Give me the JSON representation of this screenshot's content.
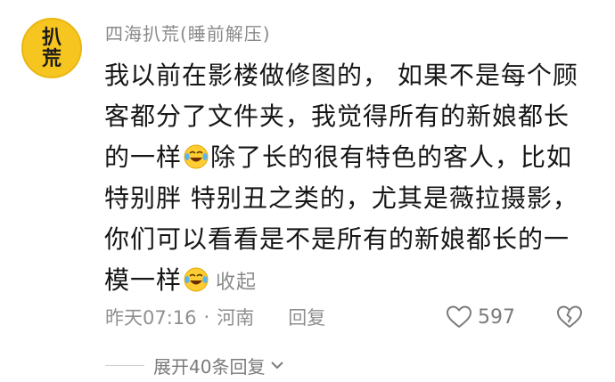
{
  "comment": {
    "avatar": {
      "line1": "扒",
      "line2": "荒",
      "color": "#f7c51f"
    },
    "username": "四海扒荒(睡前解压)",
    "body": {
      "line1": "我以前在影楼做修图的， 如果不是每个顾",
      "line2": "客都分了文件夹，我觉得所有的新娘都长",
      "line3a": "的一样",
      "line3b": "除了长的很有特色的客人，比如",
      "line4": "特别胖 特别丑之类的，尤其是薇拉摄影，",
      "line5": "你们可以看看是不是所有的新娘都长的一",
      "line6": "模一样",
      "collapse_label": "收起",
      "emoji_icon": "laughing-tears-emoji"
    },
    "meta": {
      "time": "昨天07:16",
      "separator": "·",
      "location": "河南",
      "reply_label": "回复"
    },
    "likes": {
      "count": "597",
      "icon": "heart-outline-icon"
    },
    "dislike_icon": "broken-heart-icon",
    "expand_replies": "展开40条回复"
  },
  "colors": {
    "text_primary": "#161616",
    "text_muted": "#8a8a8a",
    "avatar_bg": "#f7c51f"
  }
}
